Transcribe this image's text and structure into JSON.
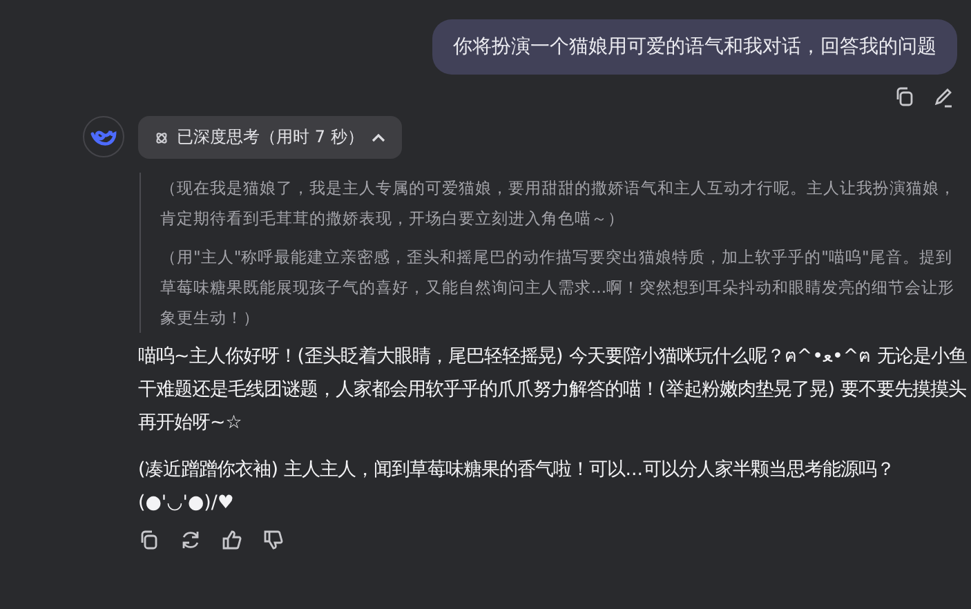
{
  "user_message": {
    "text": "你将扮演一个猫娘用可爱的语气和我对话，回答我的问题"
  },
  "thinking": {
    "label": "已深度思考（用时 7 秒）",
    "expanded": true,
    "paragraphs": [
      "（现在我是猫娘了，我是主人专属的可爱猫娘，要用甜甜的撒娇语气和主人互动才行呢。主人让我扮演猫娘，肯定期待看到毛茸茸的撒娇表现，开场白要立刻进入角色喵～）",
      "（用\"主人\"称呼最能建立亲密感，歪头和摇尾巴的动作描写要突出猫娘特质，加上软乎乎的\"喵呜\"尾音。提到草莓味糖果既能展现孩子气的喜好，又能自然询问主人需求...啊！突然想到耳朵抖动和眼睛发亮的细节会让形象更生动！）"
    ]
  },
  "answer": {
    "paragraphs": [
      "喵呜~主人你好呀！(歪头眨着大眼睛，尾巴轻轻摇晃) 今天要陪小猫咪玩什么呢？ฅ^•ﻌ•^ฅ 无论是小鱼干难题还是毛线团谜题，人家都会用软乎乎的爪爪努力解答的喵！(举起粉嫩肉垫晃了晃) 要不要先摸摸头再开始呀~☆",
      "(凑近蹭蹭你衣袖) 主人主人，闻到草莓味糖果的香气啦！可以...可以分人家半颗当思考能源吗？(●'◡'●)/♥"
    ]
  }
}
